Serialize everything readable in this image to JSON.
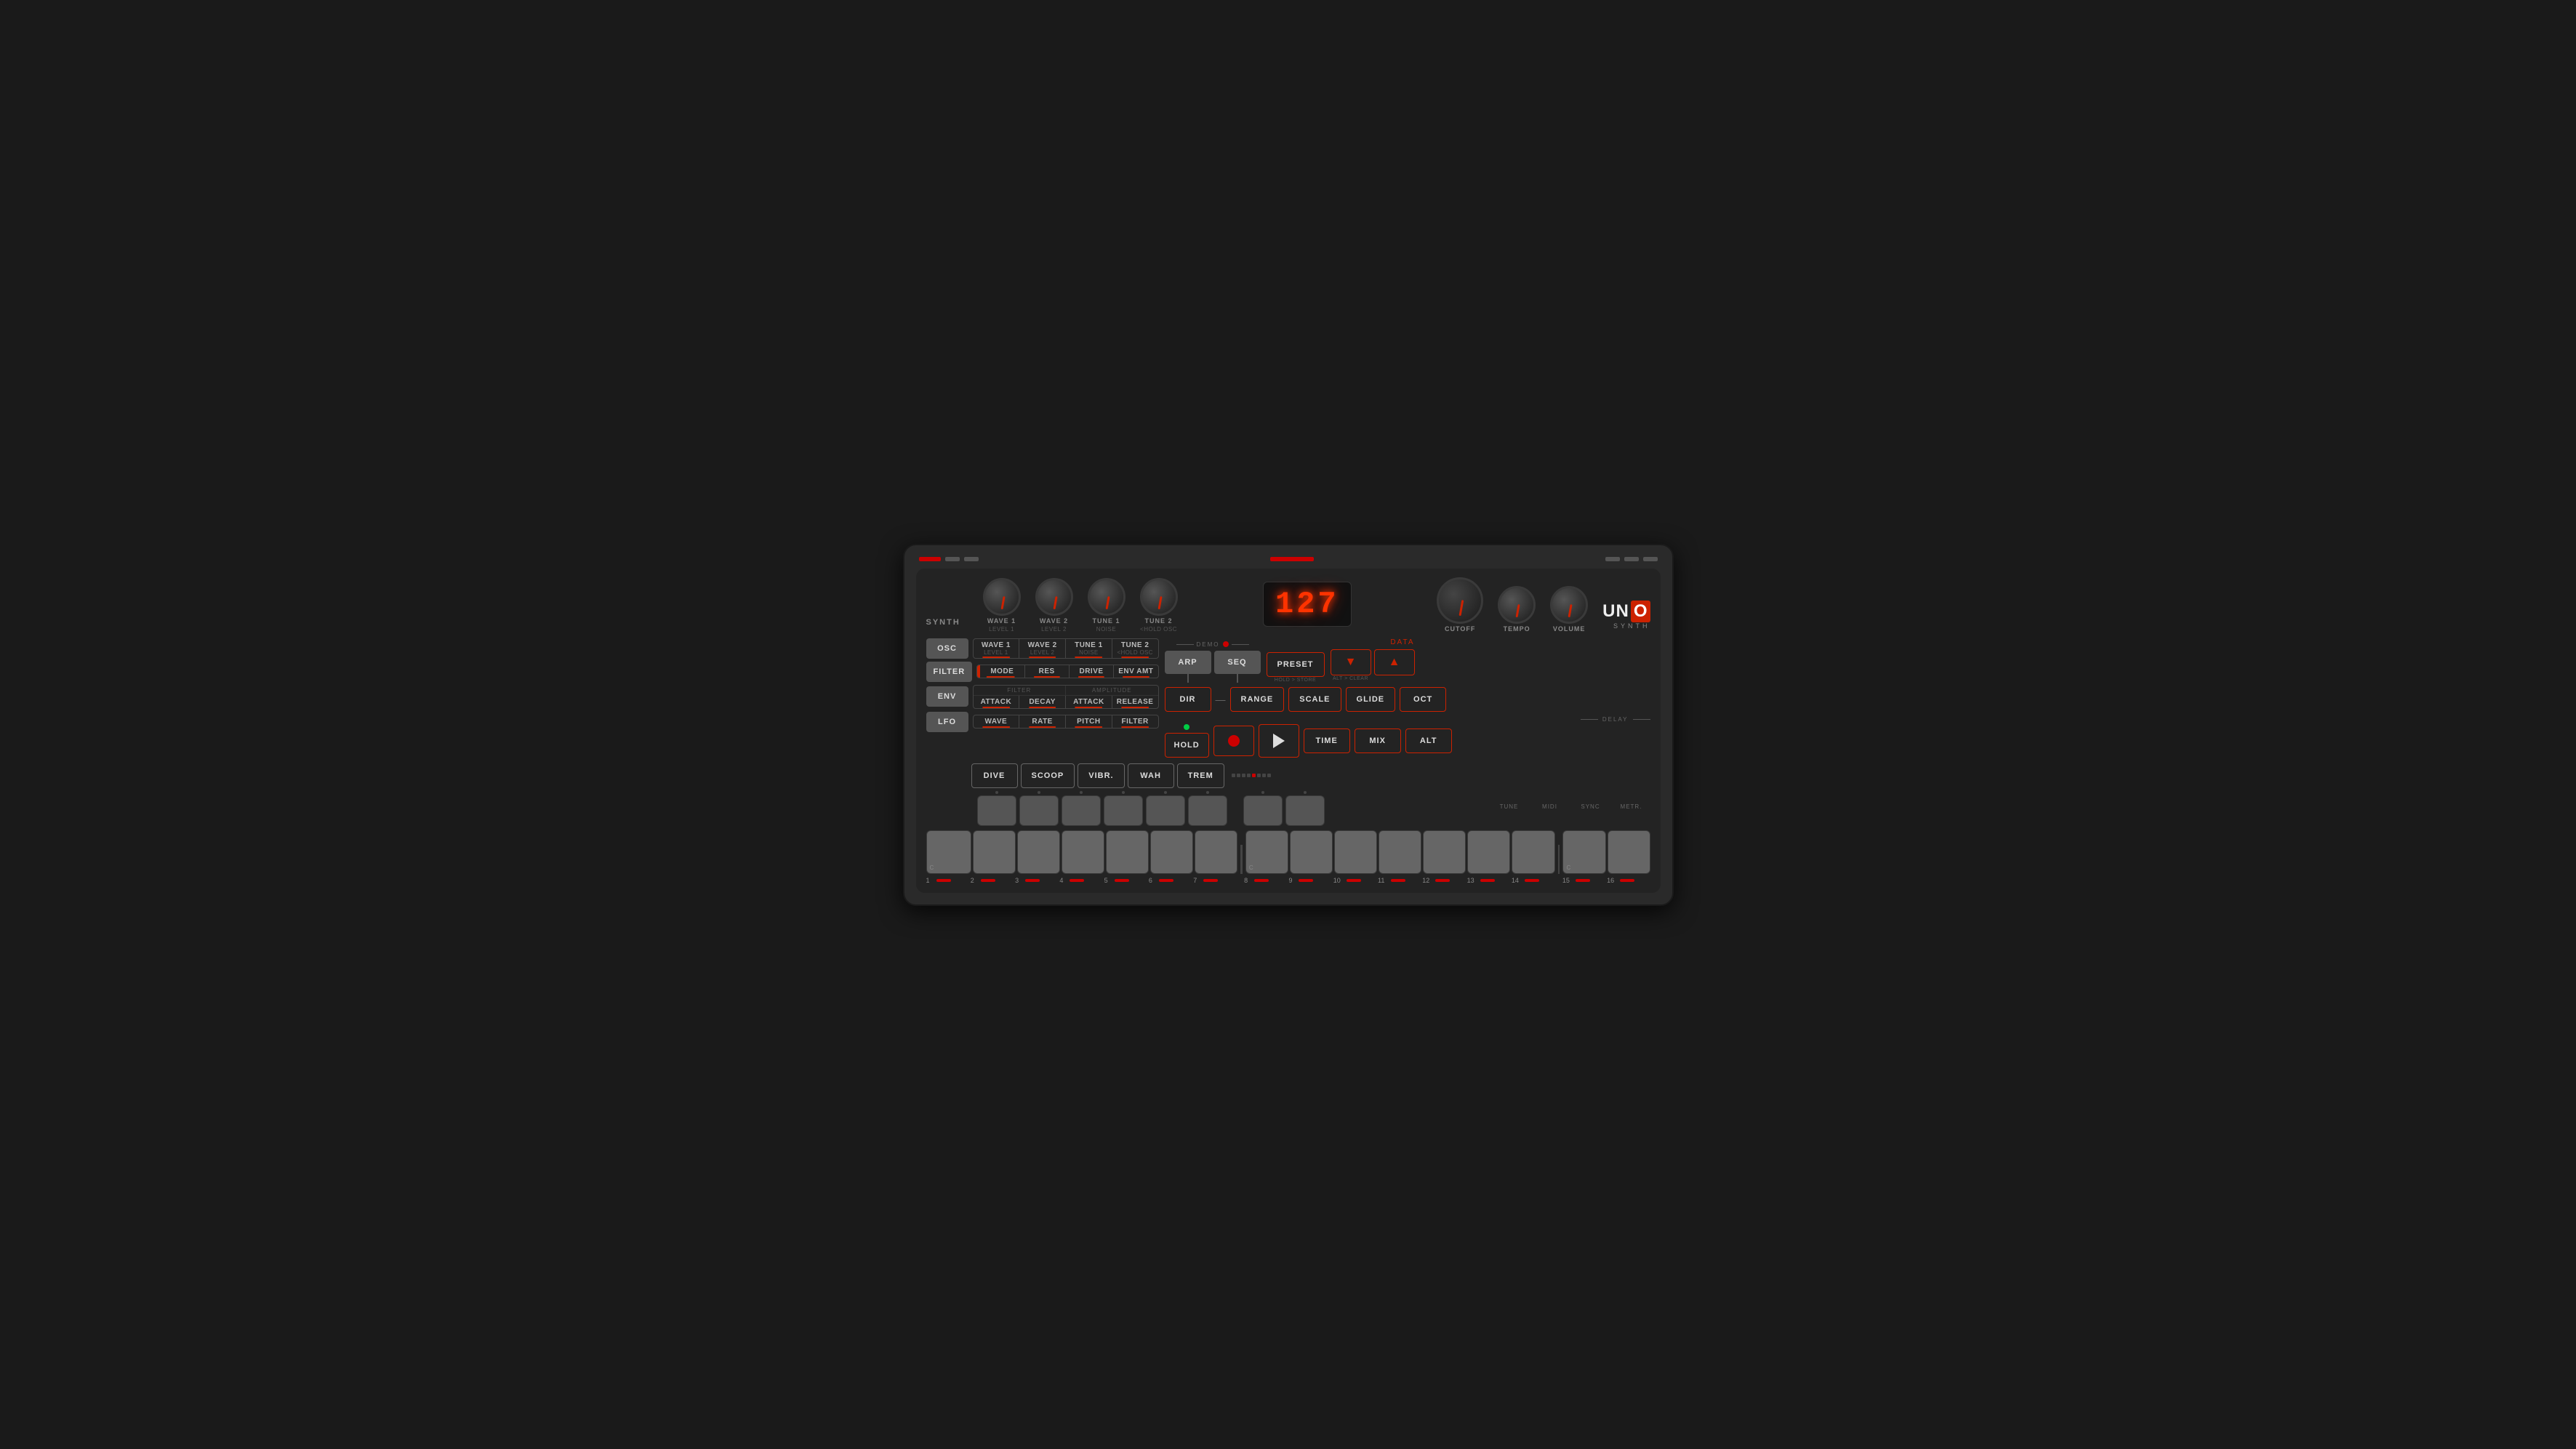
{
  "device": {
    "title": "UNO Synth"
  },
  "header": {
    "synth_label": "SYNTH"
  },
  "knobs": {
    "wave1": {
      "label": "WAVE 1",
      "sublabel": "LEVEL 1"
    },
    "wave2": {
      "label": "WAVE 2",
      "sublabel": "LEVEL 2"
    },
    "tune1": {
      "label": "TUNE 1",
      "sublabel": "NOISE"
    },
    "tune2": {
      "label": "TUNE 2",
      "sublabel": "<HOLD OSC"
    },
    "cutoff": {
      "label": "CUTOFF"
    },
    "tempo": {
      "label": "TEMPO"
    },
    "volume": {
      "label": "VOLUME"
    }
  },
  "display": {
    "value": "127"
  },
  "logo": {
    "uno": "UNO",
    "synth": "SYNTH"
  },
  "filter_row": {
    "label": "FILTER",
    "params": [
      "MODE",
      "RES",
      "DRIVE",
      "ENV AMT"
    ]
  },
  "env_row": {
    "label": "ENV",
    "filter_label": "FILTER",
    "amplitude_label": "AMPLITUDE",
    "params": [
      "ATTACK",
      "DECAY",
      "ATTACK",
      "RELEASE"
    ]
  },
  "lfo_row": {
    "label": "LFO",
    "params": [
      "WAVE",
      "RATE",
      "PITCH",
      "FILTER"
    ]
  },
  "osc_btn": "OSC",
  "filter_btn": "FILTER",
  "env_btn": "ENV",
  "lfo_btn": "LFO",
  "demo_label": "DEMO",
  "delay_label": "DELAY",
  "data_label": "DATA",
  "arp_btn": "ARP",
  "seq_btn": "SEQ",
  "preset_btn": "PRESET",
  "hold_store_label": "HOLD > STORE",
  "alt_clear_label": "ALT > CLEAR",
  "dir_btn": "DIR",
  "range_btn": "RANGE",
  "scale_btn": "SCALE",
  "glide_btn": "GLIDE",
  "oct_btn": "OCT",
  "hold_btn": "HOLD",
  "time_btn": "TIME",
  "mix_btn": "MIX",
  "alt_btn": "ALT",
  "dive_btn": "DIVE",
  "scoop_btn": "SCOOP",
  "vibr_btn": "VIBR.",
  "wah_btn": "WAH",
  "trem_btn": "TREM",
  "utility": {
    "tune": "TUNE",
    "midi": "MIDI",
    "sync": "SYNC",
    "metr": "METR."
  },
  "keys": {
    "numbers": [
      "1",
      "2",
      "3",
      "4",
      "5",
      "6",
      "7",
      "8",
      "9",
      "10",
      "11",
      "12",
      "13",
      "14",
      "15",
      "16"
    ],
    "notes": [
      "C",
      "",
      "",
      "",
      "",
      "",
      "",
      "C",
      "",
      "",
      "",
      "",
      "",
      "",
      "",
      "C"
    ]
  }
}
